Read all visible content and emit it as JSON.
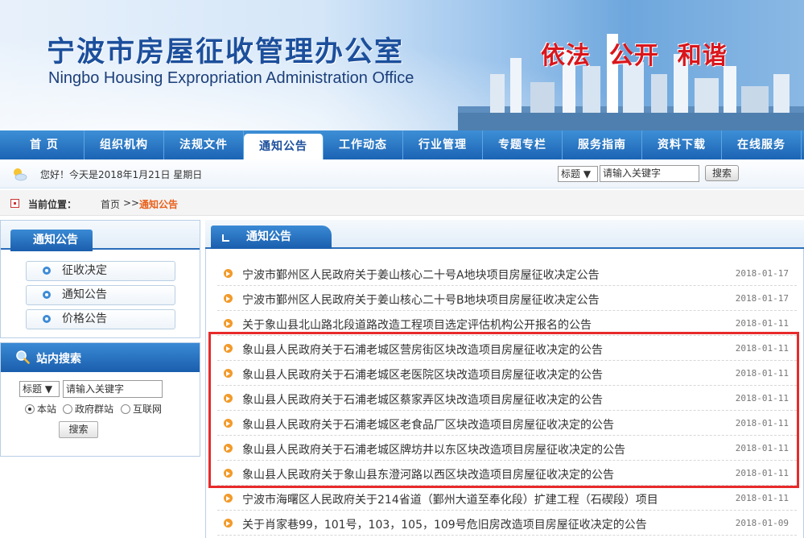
{
  "header": {
    "title": "宁波市房屋征收管理办公室",
    "subtitle": "Ningbo Housing Expropriation Administration Office",
    "slogan": "依法  公开  和谐"
  },
  "nav": {
    "items": [
      {
        "label": "首 页"
      },
      {
        "label": "组织机构"
      },
      {
        "label": "法规文件"
      },
      {
        "label": "通知公告"
      },
      {
        "label": "工作动态"
      },
      {
        "label": "行业管理"
      },
      {
        "label": "专题专栏"
      },
      {
        "label": "服务指南"
      },
      {
        "label": "资料下载"
      },
      {
        "label": "在线服务"
      }
    ],
    "active_index": 3
  },
  "greeting": {
    "text": "您好！今天是2018年1月21日 星期日"
  },
  "top_search": {
    "select_value": "标题 ▼",
    "input_value": "请输入关键字",
    "button_label": "搜索"
  },
  "breadcrumb": {
    "label": "当前位置：",
    "home": "首页",
    "separator": ">>",
    "current": "通知公告"
  },
  "sidebar": {
    "notice_title": "通知公告",
    "items": [
      {
        "label": "征收决定"
      },
      {
        "label": "通知公告"
      },
      {
        "label": "价格公告"
      }
    ],
    "search": {
      "title": "站内搜索",
      "select_value": "标题 ▼",
      "input_value": "请输入关键字",
      "radios": [
        {
          "label": "本站",
          "checked": true
        },
        {
          "label": "政府群站",
          "checked": false
        },
        {
          "label": "互联网",
          "checked": false
        }
      ],
      "button_label": "搜索"
    }
  },
  "main": {
    "title": "通知公告",
    "rows": [
      {
        "title": "宁波市鄞州区人民政府关于姜山核心二十号A地块项目房屋征收决定公告",
        "date": "2018-01-17"
      },
      {
        "title": "宁波市鄞州区人民政府关于姜山核心二十号B地块项目房屋征收决定公告",
        "date": "2018-01-17"
      },
      {
        "title": "关于象山县北山路北段道路改造工程项目选定评估机构公开报名的公告",
        "date": "2018-01-11"
      },
      {
        "title": "象山县人民政府关于石浦老城区营房街区块改造项目房屋征收决定的公告",
        "date": "2018-01-11"
      },
      {
        "title": "象山县人民政府关于石浦老城区老医院区块改造项目房屋征收决定的公告",
        "date": "2018-01-11"
      },
      {
        "title": "象山县人民政府关于石浦老城区蔡家弄区块改造项目房屋征收决定的公告",
        "date": "2018-01-11"
      },
      {
        "title": "象山县人民政府关于石浦老城区老食品厂区块改造项目房屋征收决定的公告",
        "date": "2018-01-11"
      },
      {
        "title": "象山县人民政府关于石浦老城区牌坊井以东区块改造项目房屋征收决定的公告",
        "date": "2018-01-11"
      },
      {
        "title": "象山县人民政府关于象山县东澄河路以西区块改造项目房屋征收决定的公告",
        "date": "2018-01-11"
      },
      {
        "title": "宁波市海曙区人民政府关于214省道（鄞州大道至奉化段）扩建工程（石碶段）项目",
        "date": "2018-01-11"
      },
      {
        "title": "关于肖家巷99，101号，103，105，109号危旧房改造项目房屋征收决定的公告",
        "date": "2018-01-09"
      }
    ]
  },
  "colors": {
    "nav_blue": "#1c63b4",
    "title_blue": "#1c4f9c",
    "slogan_red": "#d9161c",
    "highlight_red": "#e82a2a",
    "bullet_orange": "#f29a2a",
    "crumb_orange": "#e8611c"
  }
}
